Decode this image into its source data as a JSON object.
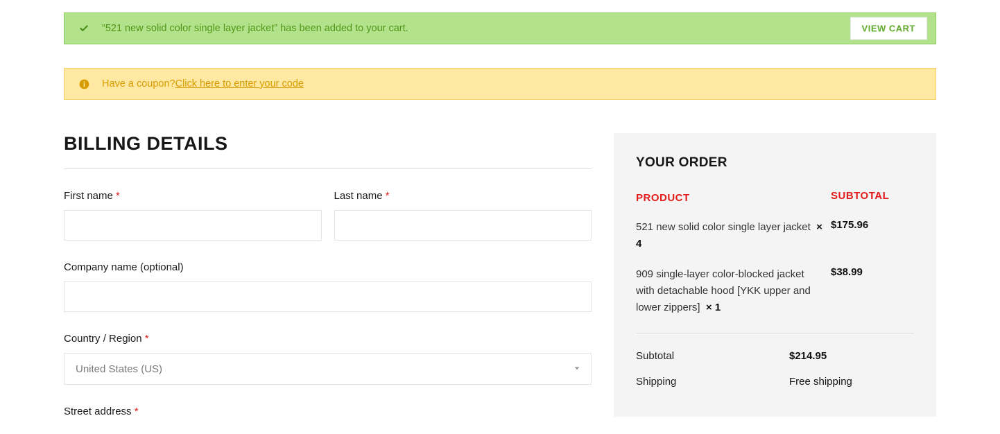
{
  "alerts": {
    "success_msg": "“521 new solid color single layer jacket” has been added to your cart.",
    "view_cart": "VIEW CART",
    "coupon_text": "Have a coupon? ",
    "coupon_link": "Click here to enter your code"
  },
  "billing": {
    "title": "BILLING DETAILS",
    "first_name_label": "First name ",
    "last_name_label": "Last name ",
    "company_label": "Company name (optional)",
    "country_label": "Country / Region ",
    "country_value": "United States (US)",
    "street_label": "Street address ",
    "required": "*"
  },
  "order": {
    "title": "YOUR ORDER",
    "product_header": "PRODUCT",
    "subtotal_header": "SUBTOTAL",
    "items": [
      {
        "name": "521 new solid color single layer jacket",
        "qty": "× 4",
        "price": "$175.96"
      },
      {
        "name": "909 single-layer color-blocked jacket with detachable hood [YKK upper and lower zippers]",
        "qty": "× 1",
        "price": "$38.99"
      }
    ],
    "subtotal_label": "Subtotal",
    "subtotal_value": "$214.95",
    "shipping_label": "Shipping",
    "shipping_value": "Free shipping"
  }
}
